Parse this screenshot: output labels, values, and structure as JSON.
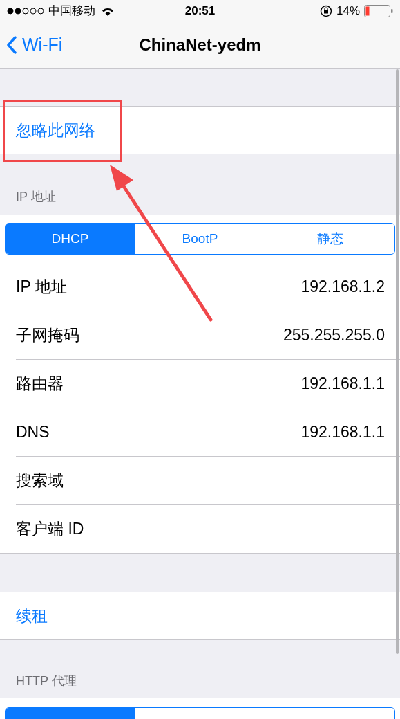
{
  "status_bar": {
    "carrier": "中国移动",
    "time": "20:51",
    "battery": "14%"
  },
  "nav": {
    "back": "Wi-Fi",
    "title": "ChinaNet-yedm"
  },
  "forget": {
    "label": "忽略此网络"
  },
  "ip_section": {
    "header": "IP 地址",
    "segments": [
      {
        "label": "DHCP",
        "selected": true
      },
      {
        "label": "BootP",
        "selected": false
      },
      {
        "label": "静态",
        "selected": false
      }
    ],
    "rows": [
      {
        "label": "IP 地址",
        "value": "192.168.1.2"
      },
      {
        "label": "子网掩码",
        "value": "255.255.255.0"
      },
      {
        "label": "路由器",
        "value": "192.168.1.1"
      },
      {
        "label": "DNS",
        "value": "192.168.1.1"
      },
      {
        "label": "搜索域"
      },
      {
        "label": "客户端 ID"
      }
    ]
  },
  "renew": {
    "label": "续租"
  },
  "http_proxy": {
    "header": "HTTP 代理",
    "segments": [
      {
        "selected": true
      },
      {
        "selected": false
      },
      {
        "selected": false
      }
    ]
  }
}
